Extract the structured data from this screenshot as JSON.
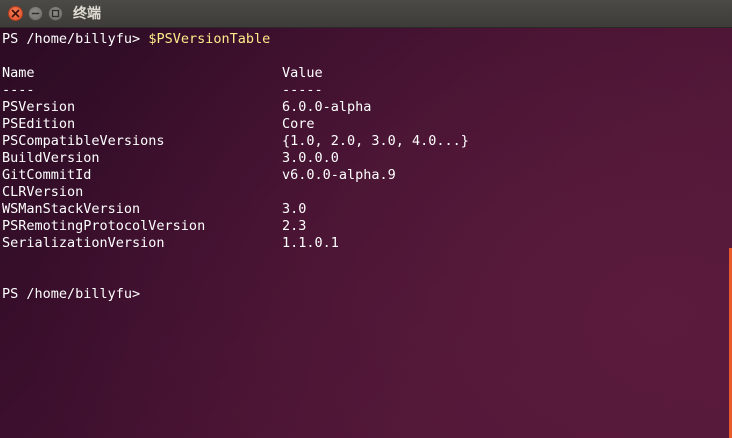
{
  "window": {
    "title": "终端"
  },
  "prompt1": {
    "prompt": "PS /home/billyfu> ",
    "command": "$PSVersionTable"
  },
  "table": {
    "header_name": "Name",
    "header_value": "Value",
    "sep_name": "----",
    "sep_value": "-----",
    "rows": [
      {
        "name": "PSVersion",
        "value": "6.0.0-alpha"
      },
      {
        "name": "PSEdition",
        "value": "Core"
      },
      {
        "name": "PSCompatibleVersions",
        "value": "{1.0, 2.0, 3.0, 4.0...}"
      },
      {
        "name": "BuildVersion",
        "value": "3.0.0.0"
      },
      {
        "name": "GitCommitId",
        "value": "v6.0.0-alpha.9"
      },
      {
        "name": "CLRVersion",
        "value": ""
      },
      {
        "name": "WSManStackVersion",
        "value": "3.0"
      },
      {
        "name": "PSRemotingProtocolVersion",
        "value": "2.3"
      },
      {
        "name": "SerializationVersion",
        "value": "1.1.0.1"
      }
    ]
  },
  "prompt2": {
    "prompt": "PS /home/billyfu>"
  },
  "colors": {
    "command": "#ffe98a",
    "close_button": "#e0502a",
    "scrollbar": "#e9592a"
  }
}
